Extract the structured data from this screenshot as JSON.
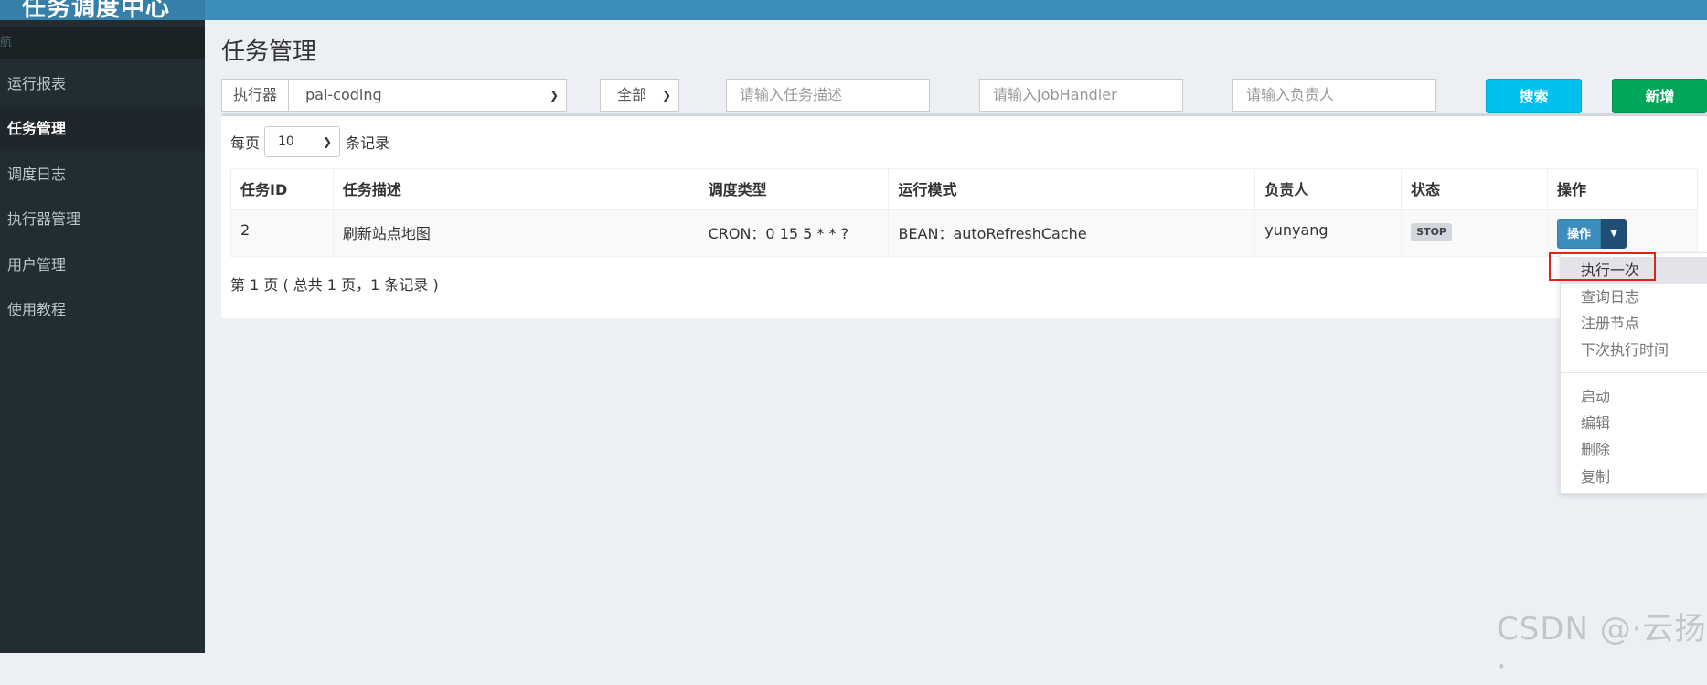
{
  "app": {
    "logo_text": "任务调度中心"
  },
  "sidebar": {
    "header": "航",
    "items": [
      {
        "label": "运行报表",
        "active": false
      },
      {
        "label": "任务管理",
        "active": true
      },
      {
        "label": "调度日志",
        "active": false
      },
      {
        "label": "执行器管理",
        "active": false
      },
      {
        "label": "用户管理",
        "active": false
      },
      {
        "label": "使用教程",
        "active": false
      }
    ]
  },
  "page": {
    "title": "任务管理"
  },
  "filters": {
    "executor_label": "执行器",
    "executor_value": "pai-coding",
    "status_value": "全部",
    "desc_placeholder": "请输入任务描述",
    "handler_placeholder": "请输入JobHandler",
    "author_placeholder": "请输入负责人",
    "search_label": "搜索",
    "add_label": "新增"
  },
  "paging": {
    "per_page_prefix": "每页",
    "per_page_value": "10",
    "per_page_suffix": "条记录",
    "summary": "第 1 页 ( 总共 1 页，1 条记录 )"
  },
  "table": {
    "headers": [
      "任务ID",
      "任务描述",
      "调度类型",
      "运行模式",
      "负责人",
      "状态",
      "操作"
    ],
    "rows": [
      {
        "id": "2",
        "desc": "刷新站点地图",
        "schedule": "CRON：0 15 5 * * ?",
        "mode": "BEAN：autoRefreshCache",
        "author": "yunyang",
        "status": "STOP",
        "op_label": "操作"
      }
    ]
  },
  "dropdown": {
    "group1": [
      "执行一次",
      "查询日志",
      "注册节点",
      "下次执行时间"
    ],
    "group2": [
      "启动",
      "编辑",
      "删除",
      "复制"
    ]
  },
  "watermark": "CSDN @·云扬·",
  "colors": {
    "topbar": "#3c8dbc",
    "sidebar": "#222d32",
    "search_button": "#00c0ef",
    "add_button": "#00a65a",
    "highlight_border": "#e2231a"
  }
}
